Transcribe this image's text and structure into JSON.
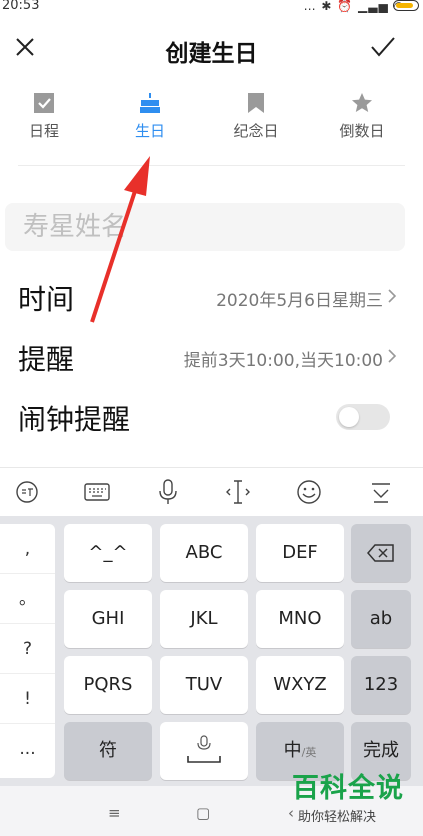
{
  "status": {
    "time": "20:53",
    "icons_text": "… ✱ ⏰ ▁▃▅ ◠"
  },
  "header": {
    "title": "创建生日",
    "close_icon": "close-icon",
    "confirm_icon": "check-icon"
  },
  "tabs": [
    {
      "label": "日程",
      "icon": "checkbox-icon",
      "active": false
    },
    {
      "label": "生日",
      "icon": "cake-icon",
      "active": true
    },
    {
      "label": "纪念日",
      "icon": "bookmark-icon",
      "active": false
    },
    {
      "label": "倒数日",
      "icon": "star-icon",
      "active": false
    }
  ],
  "form": {
    "name_placeholder": "寿星姓名",
    "time_label": "时间",
    "time_value": "2020年5月6日星期三",
    "reminder_label": "提醒",
    "reminder_value": "提前3天10:00,当天10:00",
    "alarm_label": "闹钟提醒",
    "alarm_enabled": false
  },
  "keyboard": {
    "symbols": [
      ",",
      "。",
      "?",
      "!",
      "..."
    ],
    "keys_row1": [
      "^_^",
      "ABC",
      "DEF"
    ],
    "keys_row2": [
      "GHI",
      "JKL",
      "MNO",
      "ab"
    ],
    "keys_row3": [
      "PQRS",
      "TUV",
      "WXYZ",
      "123"
    ],
    "keys_row4": [
      "符",
      "中/英",
      "完成"
    ],
    "zh": "中",
    "en": "/英"
  },
  "nav": {
    "menu": "≡",
    "home": "▢",
    "back": "‹"
  },
  "watermark": {
    "title": "百科全说",
    "subtitle": "助你轻松解决"
  },
  "colors": {
    "accent": "#2f8ef0",
    "arrow": "#e8302a",
    "watermark": "#1aa34a"
  }
}
